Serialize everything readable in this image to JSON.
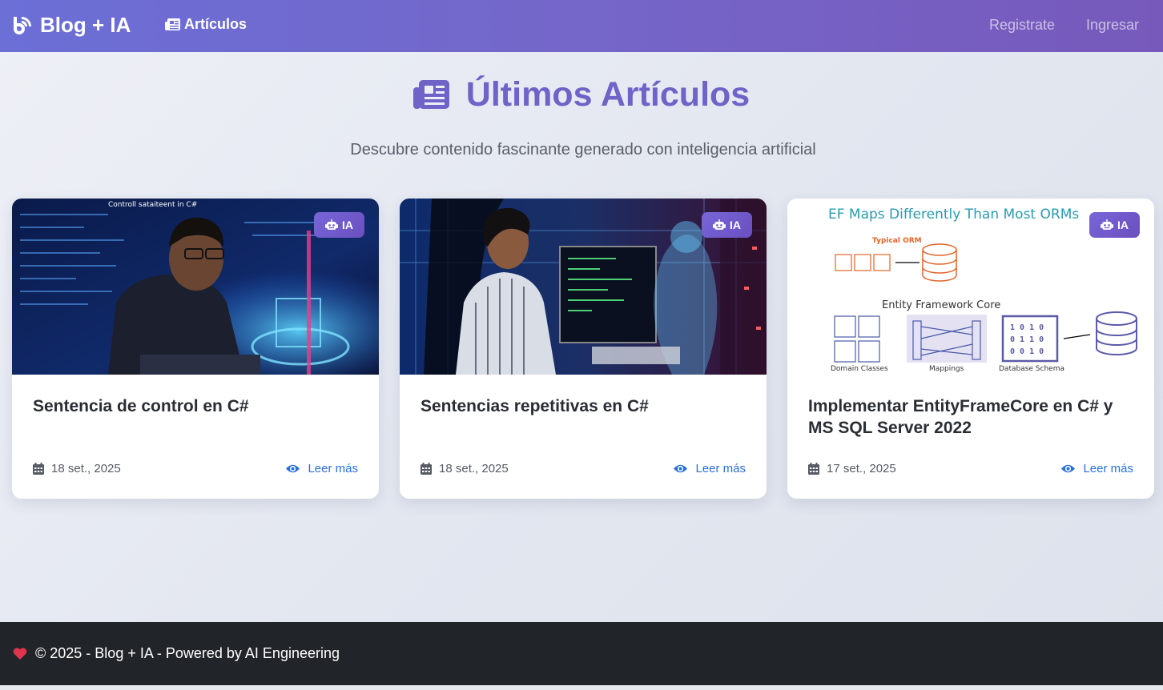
{
  "navbar": {
    "brand": "Blog + IA",
    "articles_link": "Artículos",
    "register_link": "Registrate",
    "login_link": "Ingresar"
  },
  "header": {
    "title": "Últimos Artículos",
    "subtitle": "Descubre contenido fascinante generado con inteligencia artificial"
  },
  "articles": [
    {
      "title": "Sentencia de control en C#",
      "date": "18 set., 2025",
      "badge": "IA",
      "read_more": "Leer más",
      "image_caption": "Controll sataiteent in C#"
    },
    {
      "title": "Sentencias repetitivas en C#",
      "date": "18 set., 2025",
      "badge": "IA",
      "read_more": "Leer más"
    },
    {
      "title": "Implementar EntityFrameCore en C# y MS SQL Server 2022",
      "date": "17 set., 2025",
      "badge": "IA",
      "read_more": "Leer más",
      "diagram": {
        "title": "EF Maps Differently Than Most ORMs",
        "typical": "Typical ORM",
        "ef_core": "Entity Framework Core",
        "domain": "Domain Classes",
        "mappings": "Mappings",
        "schema": "Database Schema"
      }
    }
  ],
  "footer": {
    "text": "© 2025 - Blog + IA - Powered by AI Engineering"
  },
  "colors": {
    "accent": "#6f63c8",
    "navbar_start": "#6b6fd6",
    "navbar_end": "#7659bb",
    "link": "#2a6fd8",
    "footer_bg": "#212529",
    "heart": "#e0334d"
  },
  "icons": {
    "brand": "blog-icon",
    "articles": "newspaper-icon",
    "badge": "robot-icon",
    "date": "calendar-icon",
    "read_more": "eye-icon",
    "footer": "heart-icon"
  }
}
